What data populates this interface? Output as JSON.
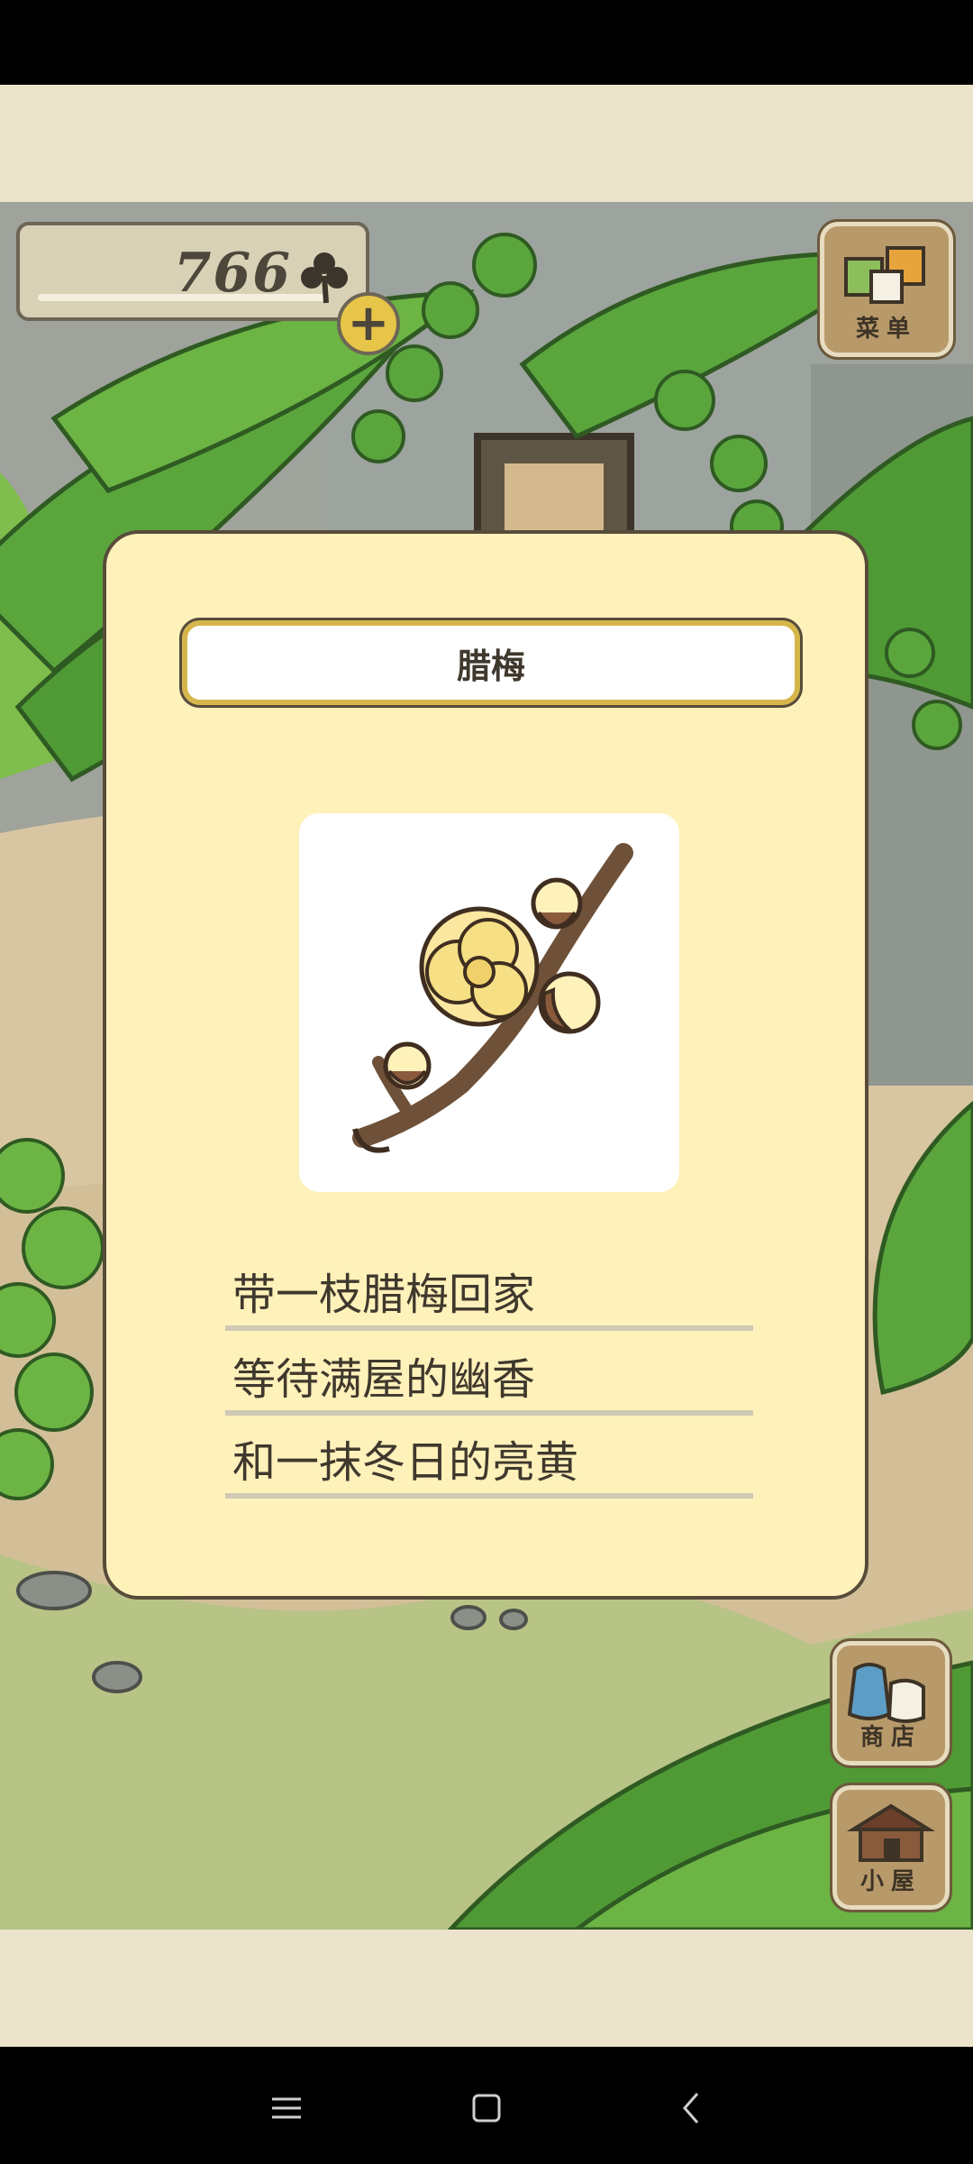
{
  "hud": {
    "clover_count": "766",
    "clover_icon": "clover-icon",
    "add_icon": "plus-icon"
  },
  "side_buttons": {
    "menu_label": "菜单",
    "shop_label": "商店",
    "house_label": "小屋"
  },
  "item_card": {
    "name": "腊梅",
    "image": "wintersweet-branch",
    "lines": [
      "带一枝腊梅回家",
      "等待满屋的幽香",
      "和一抹冬日的亮黄"
    ]
  },
  "system_nav": {
    "icons": [
      "menu-icon",
      "home-icon",
      "back-icon"
    ]
  },
  "colors": {
    "card_background": "#fff1ba",
    "title_border": "#d6b64a",
    "app_band": "#ebe3cb"
  }
}
